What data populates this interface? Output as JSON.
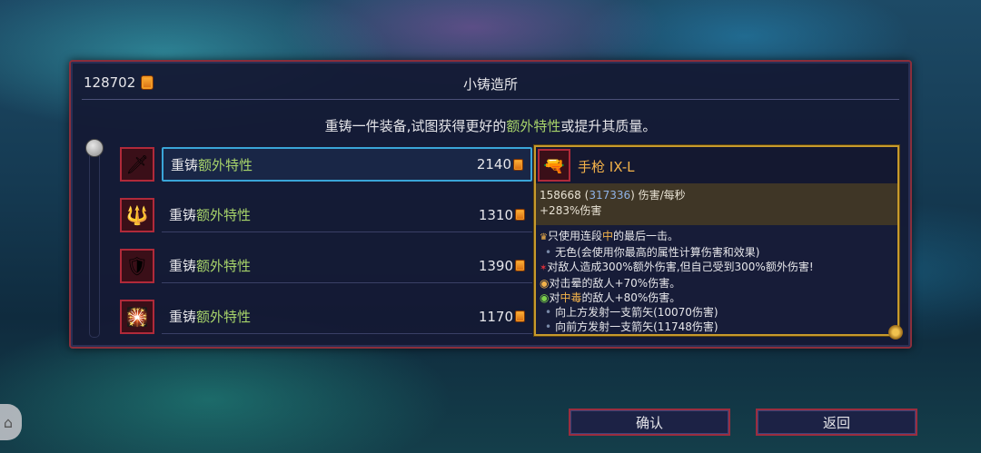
{
  "header": {
    "currency_value": "128702",
    "title": "小铸造所"
  },
  "description": {
    "before": "重铸一件装备,试图获得更好的",
    "highlight": "额外特性",
    "after": "或提升其质量。"
  },
  "items": [
    {
      "icon": "crossbow-icon",
      "glyph": "🗡",
      "label_main": "重铸",
      "label_highlight": "额外特性",
      "cost": "2140",
      "selected": true
    },
    {
      "icon": "spear-icon",
      "glyph": "🔱",
      "label_main": "重铸",
      "label_highlight": "额外特性",
      "cost": "1310",
      "selected": false
    },
    {
      "icon": "shield-icon",
      "glyph": "🛡",
      "label_main": "重铸",
      "label_highlight": "额外特性",
      "cost": "1390",
      "selected": false
    },
    {
      "icon": "bomb-icon",
      "glyph": "🎇",
      "label_main": "重铸",
      "label_highlight": "额外特性",
      "cost": "1170",
      "selected": false
    }
  ],
  "tooltip": {
    "name": "手枪 IX-L",
    "dps": "158668",
    "dps_alt": "317336",
    "dps_suffix": " 伤害/每秒",
    "bonus": "+283%伤害",
    "lines": {
      "l1_pre": "只使用连段",
      "l1_hl": "中",
      "l1_post": "的最后一击。",
      "l2": "无色(会使用你最高的属性计算伤害和效果)",
      "l3": "对敌人造成300%额外伤害,但自己受到300%额外伤害!",
      "l4": "对击晕的敌人+70%伤害。",
      "l5_pre": "对",
      "l5_hl": "中毒",
      "l5_post": "的敌人+80%伤害。",
      "l6": "向上方发射一支箭矢(10070伤害)",
      "l7": "向前方发射一支箭矢(11748伤害)"
    }
  },
  "buttons": {
    "confirm": "确认",
    "back": "返回"
  },
  "colors": {
    "accent_green": "#a7d36a",
    "accent_gold": "#f3b24a",
    "border_red": "#b02a3a",
    "selection_blue": "#3aa5d8"
  }
}
